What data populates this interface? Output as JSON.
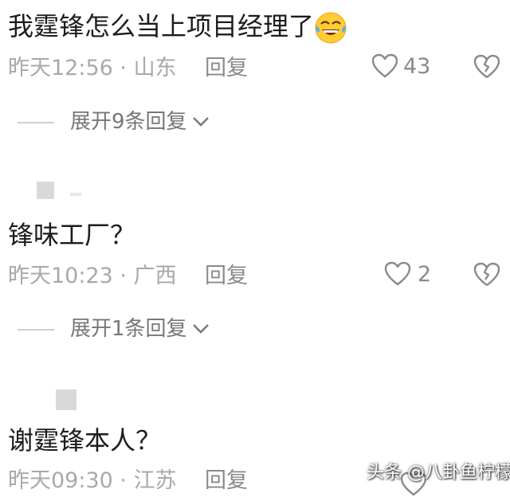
{
  "comments": [
    {
      "text": "我霆锋怎么当上项目经理了",
      "time": "昨天12:56",
      "separator": "·",
      "location": "山东",
      "reply_label": "回复",
      "likes": "43",
      "expand_label": "展开9条回复"
    },
    {
      "text": "锋味工厂？",
      "time": "昨天10:23",
      "separator": "·",
      "location": "广西",
      "reply_label": "回复",
      "likes": "2",
      "expand_label": "展开1条回复"
    },
    {
      "text": "谢霆锋本人？",
      "time": "昨天09:30",
      "separator": "·",
      "location": "江苏",
      "reply_label": "回复"
    }
  ],
  "watermark": "头条 @八卦鱼柠檬",
  "icons": [
    "laughing-crying-emoji",
    "heart-icon",
    "broken-heart-icon",
    "chevron-down-icon"
  ]
}
